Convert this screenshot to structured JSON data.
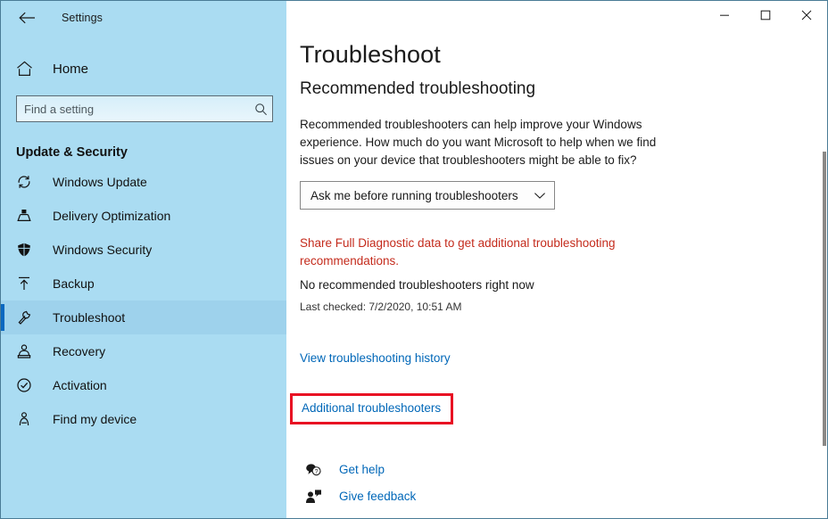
{
  "window": {
    "app_title": "Settings",
    "back_icon": "back-arrow-icon",
    "controls": {
      "minimize": "minimize-icon",
      "maximize": "maximize-icon",
      "close": "close-icon"
    }
  },
  "sidebar": {
    "home_label": "Home",
    "home_icon": "home-icon",
    "search": {
      "placeholder": "Find a setting",
      "value": "",
      "icon": "search-icon"
    },
    "section_title": "Update & Security",
    "accent_color": "#0a68c0",
    "background_color": "#aadcf2",
    "items": [
      {
        "label": "Windows Update",
        "icon": "sync-icon",
        "selected": false
      },
      {
        "label": "Delivery Optimization",
        "icon": "delivery-optimization-icon",
        "selected": false
      },
      {
        "label": "Windows Security",
        "icon": "shield-icon",
        "selected": false
      },
      {
        "label": "Backup",
        "icon": "upload-arrow-icon",
        "selected": false
      },
      {
        "label": "Troubleshoot",
        "icon": "wrench-icon",
        "selected": true
      },
      {
        "label": "Recovery",
        "icon": "recovery-icon",
        "selected": false
      },
      {
        "label": "Activation",
        "icon": "check-circle-icon",
        "selected": false
      },
      {
        "label": "Find my device",
        "icon": "person-locate-icon",
        "selected": false
      }
    ]
  },
  "main": {
    "page_title": "Troubleshoot",
    "sub_heading": "Recommended troubleshooting",
    "description": "Recommended troubleshooters can help improve your Windows experience. How much do you want Microsoft to help when we find issues on your device that troubleshooters might be able to fix?",
    "dropdown": {
      "value": "Ask me before running troubleshooters",
      "chevron_icon": "chevron-down-icon"
    },
    "diagnostic_link": "Share Full Diagnostic data to get additional troubleshooting recommendations.",
    "diagnostic_link_color": "#c42b1c",
    "status_text": "No recommended troubleshooters right now",
    "last_checked": "Last checked: 7/2/2020, 10:51 AM",
    "history_link": "View troubleshooting history",
    "additional_link": "Additional troubleshooters",
    "highlight_color": "#e81123",
    "link_color": "#0067b8",
    "help_links": [
      {
        "label": "Get help",
        "icon": "get-help-icon"
      },
      {
        "label": "Give feedback",
        "icon": "give-feedback-icon"
      }
    ]
  }
}
